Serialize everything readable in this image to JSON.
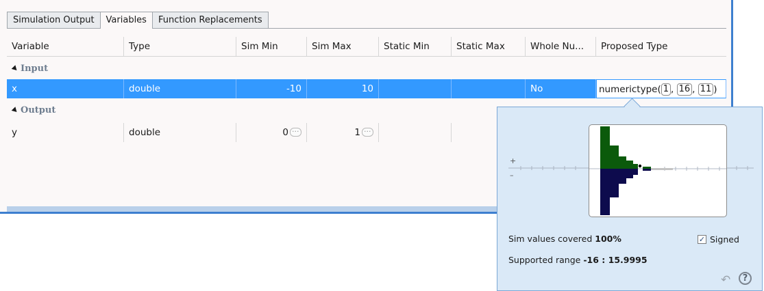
{
  "tabs": [
    "Simulation Output",
    "Variables",
    "Function Replacements"
  ],
  "columns": [
    "Variable",
    "Type",
    "Sim Min",
    "Sim Max",
    "Static Min",
    "Static Max",
    "Whole Nu...",
    "Proposed Type"
  ],
  "groups": {
    "input": "Input",
    "output": "Output"
  },
  "rows": [
    {
      "variable": "x",
      "type": "double",
      "sim_min": "-10",
      "sim_max": "10",
      "static_min": "",
      "static_max": "",
      "whole": "No",
      "proposed": {
        "prefix": "numerictype(",
        "p1": "1",
        "p2": "16",
        "p3": "11",
        "suffix": ")"
      }
    },
    {
      "variable": "y",
      "type": "double",
      "sim_min": "0",
      "sim_max": "1",
      "static_min": "",
      "static_max": "",
      "whole": "",
      "proposed": ""
    }
  ],
  "popup": {
    "plus": "+",
    "minus": "–",
    "covered_label": "Sim values covered",
    "covered_value": "100%",
    "signed_label": "Signed",
    "signed_checked": true,
    "range_label": "Supported range",
    "range_value": "-16 : 15.9995"
  },
  "colors": {
    "selection": "#3399ff",
    "positive_bar": "#0b5a0b",
    "negative_bar": "#0d0b4d",
    "popup_bg": "#dae9f7"
  }
}
